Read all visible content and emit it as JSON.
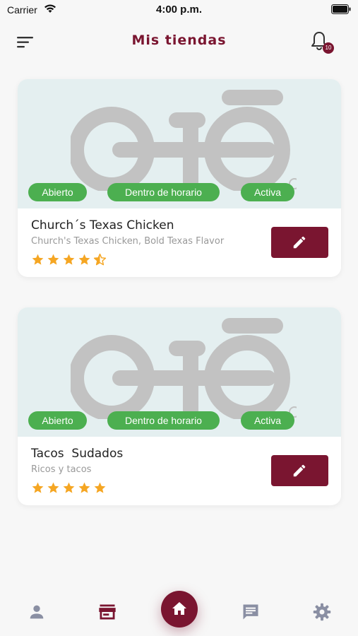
{
  "status_bar": {
    "carrier": "Carrier",
    "time": "4:00 p.m."
  },
  "header": {
    "title": "Mis tiendas",
    "notification_count": "10"
  },
  "stores": [
    {
      "name": "Church´s Texas Chicken",
      "description": "Church's Texas Chicken, Bold Texas Flavor",
      "rating": 4.5,
      "tags": [
        "Abierto",
        "Dentro de horario",
        "Activa"
      ]
    },
    {
      "name": "Tacos  Sudados",
      "description": "Ricos y tacos",
      "rating": 5,
      "tags": [
        "Abierto",
        "Dentro de horario",
        "Activa"
      ]
    }
  ],
  "tabbar": {
    "icons": [
      "person-icon",
      "store-icon",
      "home-icon",
      "chat-icon",
      "settings-icon"
    ],
    "active": "store-icon"
  },
  "colors": {
    "brand": "#7a1530",
    "tag_green": "#4caf50",
    "star": "#f5a623",
    "card_image_bg": "#e4eff0",
    "inactive_icon": "#8a8fa3"
  }
}
